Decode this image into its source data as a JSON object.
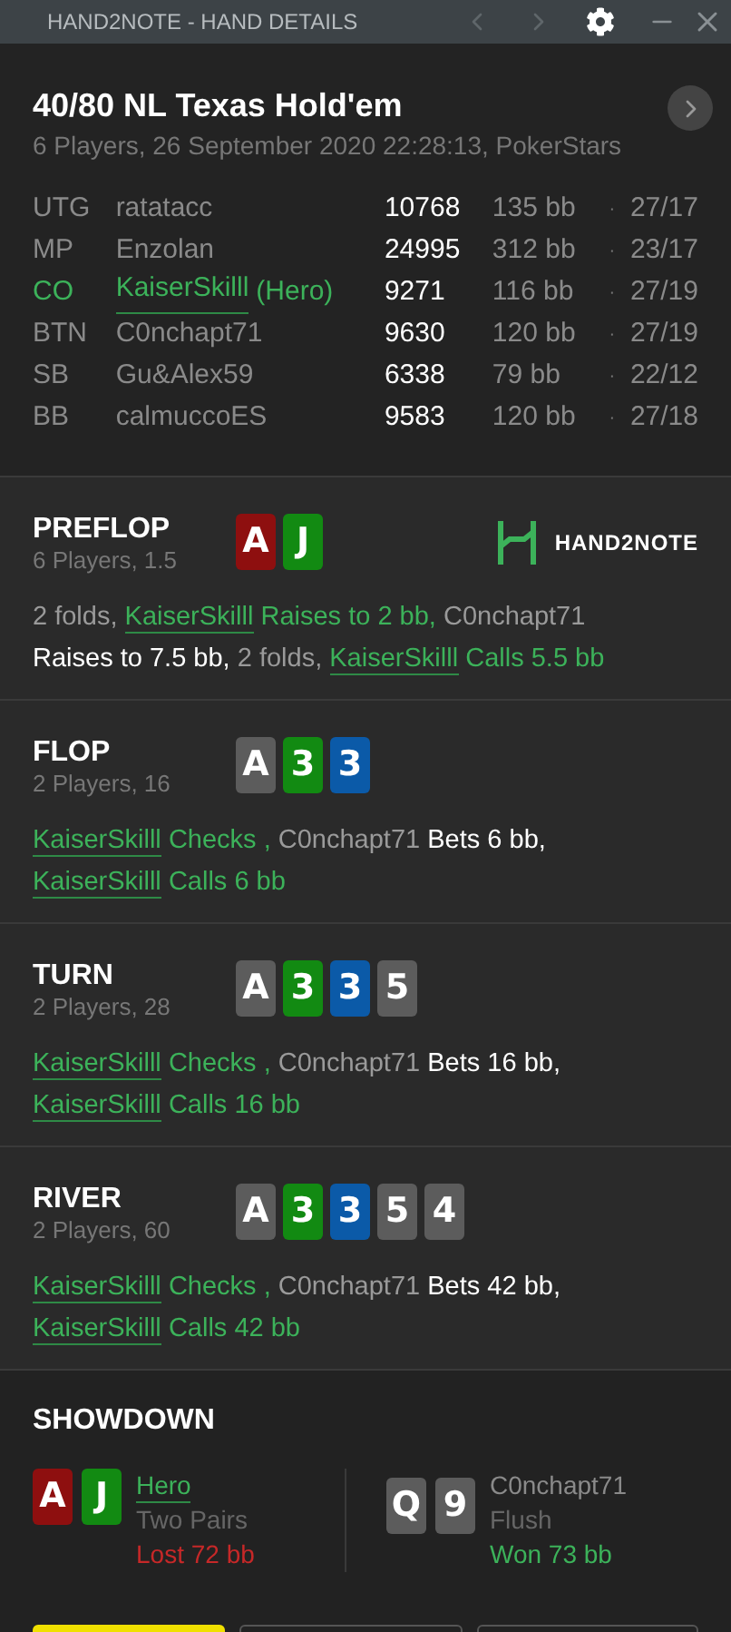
{
  "window": {
    "title": "HAND2NOTE - HAND DETAILS"
  },
  "hand": {
    "title": "40/80 NL Texas Hold'em",
    "subtitle": "6 Players, 26 September 2020 22:28:13, PokerStars"
  },
  "players": [
    {
      "position": "UTG",
      "name": "ratatacc",
      "hero": false,
      "chips": "10768",
      "bb": "135 bb",
      "sep": "·",
      "stats": "27/17"
    },
    {
      "position": "MP",
      "name": "Enzolan",
      "hero": false,
      "chips": "24995",
      "bb": "312 bb",
      "sep": "·",
      "stats": "23/17"
    },
    {
      "position": "CO",
      "name": "KaiserSkilll",
      "hero": true,
      "tag": "(Hero)",
      "chips": "9271",
      "bb": "116 bb",
      "sep": "·",
      "stats": "27/19"
    },
    {
      "position": "BTN",
      "name": "C0nchapt71",
      "hero": false,
      "chips": "9630",
      "bb": "120 bb",
      "sep": "·",
      "stats": "27/19"
    },
    {
      "position": "SB",
      "name": "Gu&Alex59",
      "hero": false,
      "chips": "6338",
      "bb": "79 bb",
      "sep": "·",
      "stats": "22/12"
    },
    {
      "position": "BB",
      "name": "calmuccoES",
      "hero": false,
      "chips": "9583",
      "bb": "120 bb",
      "sep": "·",
      "stats": "27/18"
    }
  ],
  "logo": {
    "text": "HAND2NOTE"
  },
  "streets": [
    {
      "name": "PREFLOP",
      "info": "6 Players, 1.5",
      "logo": true,
      "cards": [
        {
          "rank": "A",
          "color": "#8e0f0f"
        },
        {
          "rank": "J",
          "color": "#128a12"
        }
      ],
      "actions": [
        {
          "kind": "plain",
          "text": "2 folds, "
        },
        {
          "kind": "hero-name",
          "text": "KaiserSkilll"
        },
        {
          "kind": "hero",
          "text": " Raises to 2 bb,"
        },
        {
          "kind": "plain",
          "text": " C0nchapt71 "
        },
        {
          "kind": "break"
        },
        {
          "kind": "villain",
          "text": "Raises to 7.5 bb,"
        },
        {
          "kind": "plain",
          "text": " 2 folds, "
        },
        {
          "kind": "hero-name",
          "text": "KaiserSkilll"
        },
        {
          "kind": "hero",
          "text": " Calls 5.5 bb"
        }
      ]
    },
    {
      "name": "FLOP",
      "info": "2 Players, 16",
      "logo": false,
      "cards": [
        {
          "rank": "A",
          "color": "#5c5c5c"
        },
        {
          "rank": "3",
          "color": "#128a12"
        },
        {
          "rank": "3",
          "color": "#0b5aa8"
        }
      ],
      "actions": [
        {
          "kind": "hero-name",
          "text": "KaiserSkilll"
        },
        {
          "kind": "hero",
          "text": " Checks ,"
        },
        {
          "kind": "plain",
          "text": " C0nchapt71 "
        },
        {
          "kind": "villain",
          "text": "Bets 6 bb,"
        },
        {
          "kind": "break"
        },
        {
          "kind": "hero-name",
          "text": "KaiserSkilll"
        },
        {
          "kind": "hero",
          "text": " Calls 6 bb"
        }
      ]
    },
    {
      "name": "TURN",
      "info": "2 Players, 28",
      "logo": false,
      "cards": [
        {
          "rank": "A",
          "color": "#5c5c5c"
        },
        {
          "rank": "3",
          "color": "#128a12"
        },
        {
          "rank": "3",
          "color": "#0b5aa8"
        },
        {
          "rank": "5",
          "color": "#5c5c5c"
        }
      ],
      "actions": [
        {
          "kind": "hero-name",
          "text": "KaiserSkilll"
        },
        {
          "kind": "hero",
          "text": " Checks ,"
        },
        {
          "kind": "plain",
          "text": " C0nchapt71 "
        },
        {
          "kind": "villain",
          "text": "Bets 16 bb,"
        },
        {
          "kind": "break"
        },
        {
          "kind": "hero-name",
          "text": "KaiserSkilll"
        },
        {
          "kind": "hero",
          "text": " Calls 16 bb"
        }
      ]
    },
    {
      "name": "RIVER",
      "info": "2 Players, 60",
      "logo": false,
      "cards": [
        {
          "rank": "A",
          "color": "#5c5c5c"
        },
        {
          "rank": "3",
          "color": "#128a12"
        },
        {
          "rank": "3",
          "color": "#0b5aa8"
        },
        {
          "rank": "5",
          "color": "#5c5c5c"
        },
        {
          "rank": "4",
          "color": "#5c5c5c"
        }
      ],
      "actions": [
        {
          "kind": "hero-name",
          "text": "KaiserSkilll"
        },
        {
          "kind": "hero",
          "text": " Checks ,"
        },
        {
          "kind": "plain",
          "text": " C0nchapt71 "
        },
        {
          "kind": "villain",
          "text": "Bets 42 bb,"
        },
        {
          "kind": "break"
        },
        {
          "kind": "hero-name",
          "text": "KaiserSkilll"
        },
        {
          "kind": "hero",
          "text": " Calls 42 bb"
        }
      ]
    }
  ],
  "showdown": {
    "title": "SHOWDOWN",
    "hands": [
      {
        "player": "Hero",
        "hero": true,
        "cards": [
          {
            "rank": "A",
            "color": "#8e0f0f"
          },
          {
            "rank": "J",
            "color": "#128a12"
          }
        ],
        "made": "Two Pairs",
        "result": "Lost 72 bb",
        "won": false
      },
      {
        "player": "C0nchapt71",
        "hero": false,
        "cards": [
          {
            "rank": "Q",
            "color": "#5c5c5c"
          },
          {
            "rank": "9",
            "color": "#5c5c5c"
          }
        ],
        "made": "Flush",
        "result": "Won 73 bb",
        "won": true
      }
    ]
  },
  "footer_buttons": [
    {
      "kind": "primary"
    },
    {
      "kind": "outline"
    },
    {
      "kind": "outline"
    }
  ]
}
